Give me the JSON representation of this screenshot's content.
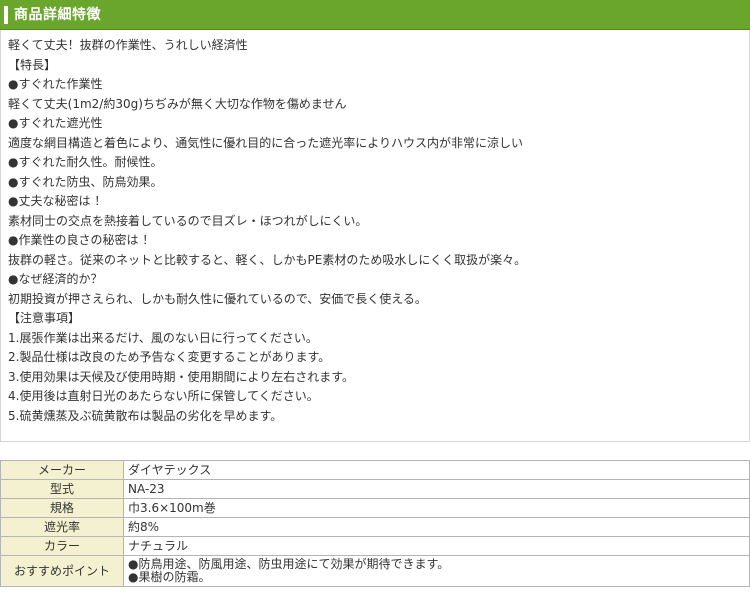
{
  "header": {
    "title": "商品詳細特徴"
  },
  "description": [
    "軽くて丈夫！抜群の作業性、うれしい経済性",
    "【特長】",
    "●すぐれた作業性",
    "軽くて丈夫(1m2/約30g)ちぢみが無く大切な作物を傷めません",
    "●すぐれた遮光性",
    "適度な網目構造と着色により、通気性に優れ目的に合った遮光率によりハウス内が非常に涼しい",
    "●すぐれた耐久性。耐候性。",
    "●すぐれた防虫、防鳥効果。",
    "●丈夫な秘密は ！",
    "素材同士の交点を熱接着しているので目ズレ・ほつれがしにくい。",
    "●作業性の良さの秘密は ！",
    "抜群の軽さ。従来のネットと比較すると、軽く、しかもPE素材のため吸水しにくく取扱が楽々。",
    "●なぜ経済的か？",
    "初期投資が押さえられ、しかも耐久性に優れているので、安価で長く使える。",
    "【注意事項】",
    "1.展張作業は出来るだけ、風のない日に行ってください。",
    "2.製品仕様は改良のため予告なく変更することがあります。",
    "3.使用効果は天候及び使用時期・使用期間により左右されます。",
    "4.使用後は直射日光のあたらない所に保管してください。",
    "5.硫黄燻蒸及ぶ硫黄散布は製品の劣化を早めます。"
  ],
  "spec": {
    "rows": [
      {
        "label": "メーカー",
        "value": [
          "ダイヤテックス"
        ]
      },
      {
        "label": "型式",
        "value": [
          "NA-23"
        ]
      },
      {
        "label": "規格",
        "value": [
          "巾3.6×100m巻"
        ]
      },
      {
        "label": "遮光率",
        "value": [
          "約8%"
        ]
      },
      {
        "label": "カラー",
        "value": [
          "ナチュラル"
        ]
      },
      {
        "label": "おすすめポイント",
        "value": [
          "●防鳥用途、防風用途、防虫用途にて効果が期待できます。",
          "●果樹の防霜。"
        ]
      }
    ]
  },
  "colors": {
    "header_bg": "#6aa52c",
    "label_bg": "#f3f1cf",
    "border": "#b5b5b5"
  }
}
